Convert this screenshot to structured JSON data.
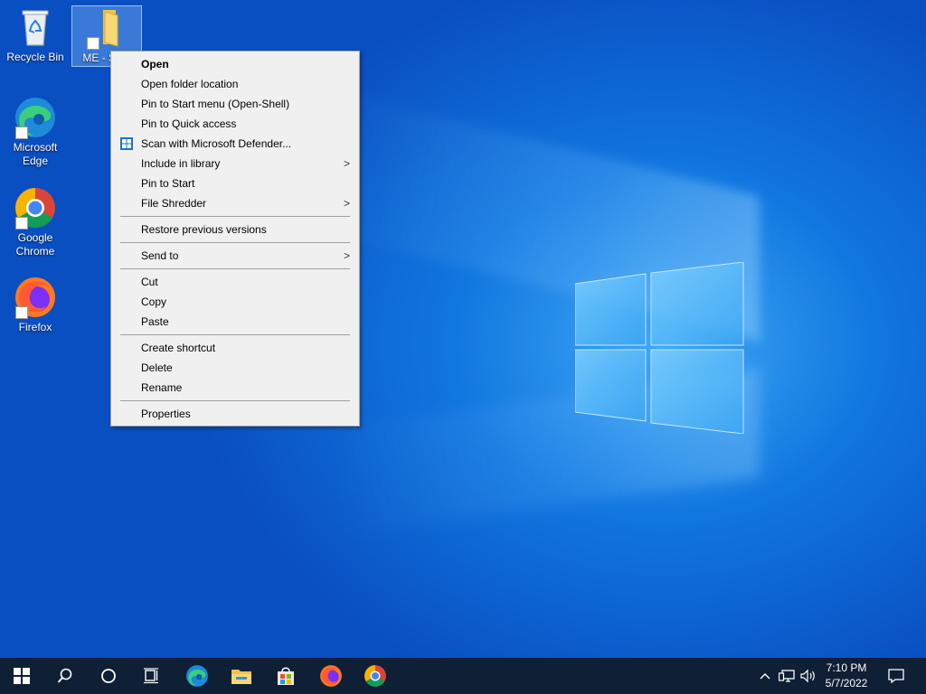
{
  "desktop": {
    "icons": [
      {
        "label": "Recycle Bin"
      },
      {
        "label": "ME - Sh..."
      },
      {
        "label": "Microsoft Edge"
      },
      {
        "label": "Google Chrome"
      },
      {
        "label": "Firefox"
      }
    ]
  },
  "context_menu": {
    "items": [
      {
        "label": "Open"
      },
      {
        "label": "Open folder location"
      },
      {
        "label": "Pin to Start menu (Open-Shell)"
      },
      {
        "label": "Pin to Quick access"
      },
      {
        "label": "Scan with Microsoft Defender..."
      },
      {
        "label": "Include in library"
      },
      {
        "label": "Pin to Start"
      },
      {
        "label": "File Shredder"
      },
      {
        "label": "Restore previous versions"
      },
      {
        "label": "Send to"
      },
      {
        "label": "Cut"
      },
      {
        "label": "Copy"
      },
      {
        "label": "Paste"
      },
      {
        "label": "Create shortcut"
      },
      {
        "label": "Delete"
      },
      {
        "label": "Rename"
      },
      {
        "label": "Properties"
      }
    ],
    "submenu_arrow": ">"
  },
  "taskbar": {
    "time": "7:10 PM",
    "date": "5/7/2022",
    "tray_chevron": "^"
  },
  "colors": {
    "accent": "#0a62d6",
    "taskbar": "#0f1f36",
    "menu_bg": "#f0f0f0"
  }
}
